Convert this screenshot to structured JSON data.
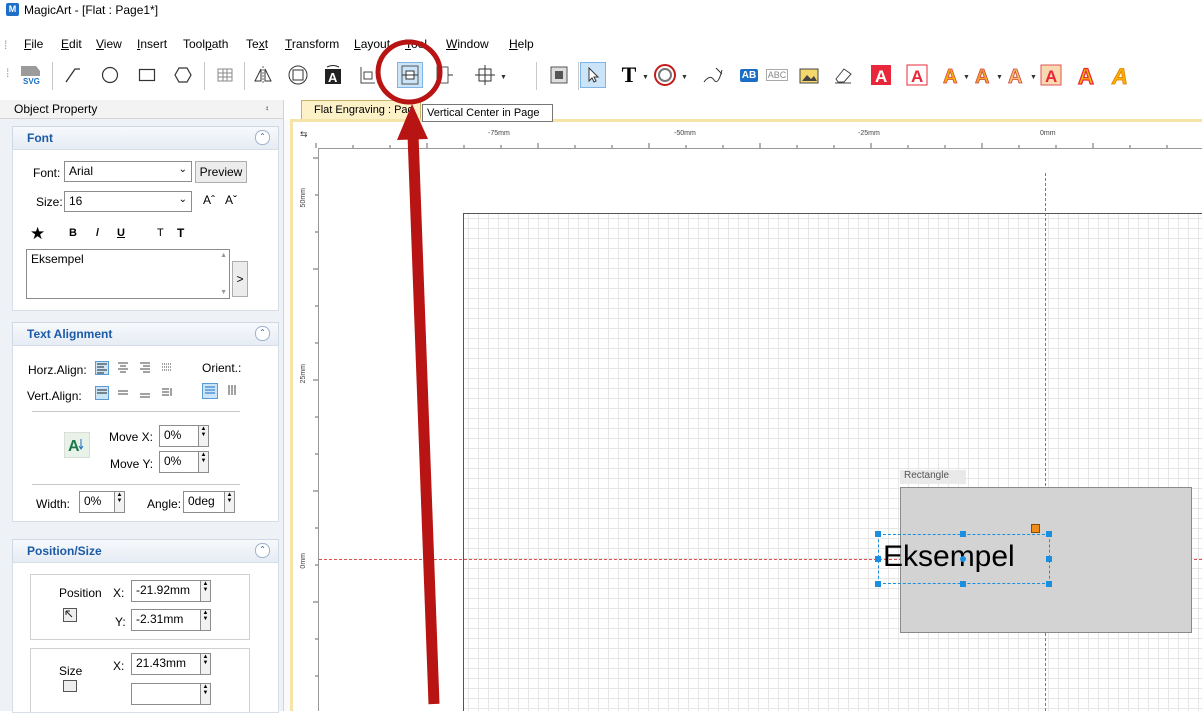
{
  "window": {
    "title": "MagicArt - [Flat : Page1*]",
    "app_icon": "M"
  },
  "menu": [
    {
      "label": "File",
      "ul": "F"
    },
    {
      "label": "Edit",
      "ul": "E"
    },
    {
      "label": "View",
      "ul": "V"
    },
    {
      "label": "Insert",
      "ul": "I"
    },
    {
      "label": "Toolpath",
      "ul": "p"
    },
    {
      "label": "Text",
      "ul": "x"
    },
    {
      "label": "Transform",
      "ul": "T"
    },
    {
      "label": "Layout",
      "ul": "L"
    },
    {
      "label": "Tool",
      "ul": "T"
    },
    {
      "label": "Window",
      "ul": "W"
    },
    {
      "label": "Help",
      "ul": "H"
    }
  ],
  "toolbar": {
    "svg_label": "SVG",
    "active_tool": "vertical-center-in-page",
    "tooltip": "Vertical Center in Page",
    "text_tool_label": "T",
    "ab_label": "AB",
    "abc_label": "ABC"
  },
  "panel": {
    "title": "Object Property",
    "pin": "⨾",
    "font": {
      "header": "Font",
      "font_label": "Font:",
      "font_value": "Arial",
      "preview_label": "Preview",
      "size_label": "Size:",
      "size_value": "16",
      "bold": "B",
      "italic": "/",
      "underline": "U",
      "t1": "T",
      "t2": "T",
      "text_value": "Eksempel",
      "arrow": ">"
    },
    "alignment": {
      "header": "Text Alignment",
      "horz_label": "Horz.Align:",
      "vert_label": "Vert.Align:",
      "orient_label": "Orient.:",
      "move_x_label": "Move X:",
      "move_x_value": "0%",
      "move_y_label": "Move Y:",
      "move_y_value": "0%",
      "width_label": "Width:",
      "width_value": "0%",
      "angle_label": "Angle:",
      "angle_value": "0deg"
    },
    "position": {
      "header": "Position/Size",
      "position_label": "Position",
      "x_label": "X:",
      "x_value": "-21.92mm",
      "y_label": "Y:",
      "y_value": "-2.31mm",
      "size_label": "Size",
      "size_x_label": "X:",
      "size_x_value": "21.43mm"
    }
  },
  "document": {
    "tab_label": "Flat Engraving : Pag",
    "ruler_h": [
      "-75mm",
      "-50mm",
      "-25mm",
      "0mm"
    ],
    "ruler_v": [
      "50mm",
      "25mm",
      "0mm"
    ],
    "rect_label": "Rectangle",
    "text_object": "Eksempel"
  },
  "colors": {
    "accent": "#1a8fe0",
    "annotation": "#b81414",
    "section_header": "#1b5aa6"
  }
}
